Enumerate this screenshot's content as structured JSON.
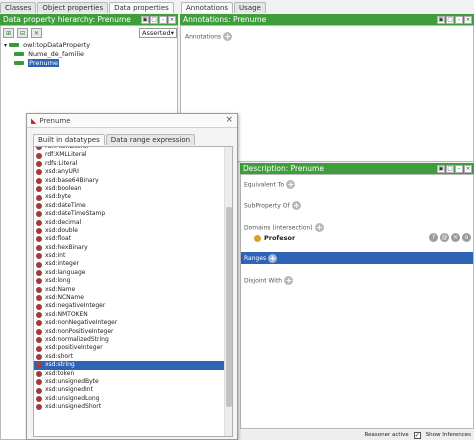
{
  "left_tabs": [
    {
      "label": "Classes",
      "active": false
    },
    {
      "label": "Object properties",
      "active": false
    },
    {
      "label": "Data properties",
      "active": true
    }
  ],
  "right_tabs": [
    {
      "label": "Annotations",
      "active": true
    },
    {
      "label": "Usage",
      "active": false
    }
  ],
  "hierarchy": {
    "title": "Data property hierarchy: Prenume",
    "dropdown_value": "Asserted",
    "root": "owl:topDataProperty",
    "children": [
      "Nume_de_familie",
      "Prenume"
    ],
    "selected": "Prenume"
  },
  "annotations": {
    "title": "Annotations: Prenume",
    "label": "Annotations"
  },
  "description": {
    "title": "Description: Prenume",
    "equivalent_to": "Equivalent To",
    "subproperty_of": "SubProperty Of",
    "domains": "Domains (intersection)",
    "domain_value": "Profesor",
    "ranges": "Ranges",
    "disjoint_with": "Disjoint With"
  },
  "dialog": {
    "title": "Prenume",
    "tabs": [
      {
        "label": "Built in datatypes",
        "active": true
      },
      {
        "label": "Data range expression",
        "active": false
      }
    ],
    "items": [
      "rdf:PlainLiteral",
      "rdf:XMLLiteral",
      "rdfs:Literal",
      "xsd:anyURI",
      "xsd:base64Binary",
      "xsd:boolean",
      "xsd:byte",
      "xsd:dateTime",
      "xsd:dateTimeStamp",
      "xsd:decimal",
      "xsd:double",
      "xsd:float",
      "xsd:hexBinary",
      "xsd:int",
      "xsd:integer",
      "xsd:language",
      "xsd:long",
      "xsd:Name",
      "xsd:NCName",
      "xsd:negativeInteger",
      "xsd:NMTOKEN",
      "xsd:nonNegativeInteger",
      "xsd:nonPositiveInteger",
      "xsd:normalizedString",
      "xsd:positiveInteger",
      "xsd:short",
      "xsd:string",
      "xsd:token",
      "xsd:unsignedByte",
      "xsd:unsignedInt",
      "xsd:unsignedLong",
      "xsd:unsignedShort"
    ],
    "selected": "xsd:string"
  },
  "status": {
    "reasoner": "Reasoner active",
    "show_inferences": "Show Inferences"
  },
  "colors": {
    "green_header": "#3f9e3c",
    "blue_header": "#2f63b6",
    "selection": "#2f63b6"
  }
}
